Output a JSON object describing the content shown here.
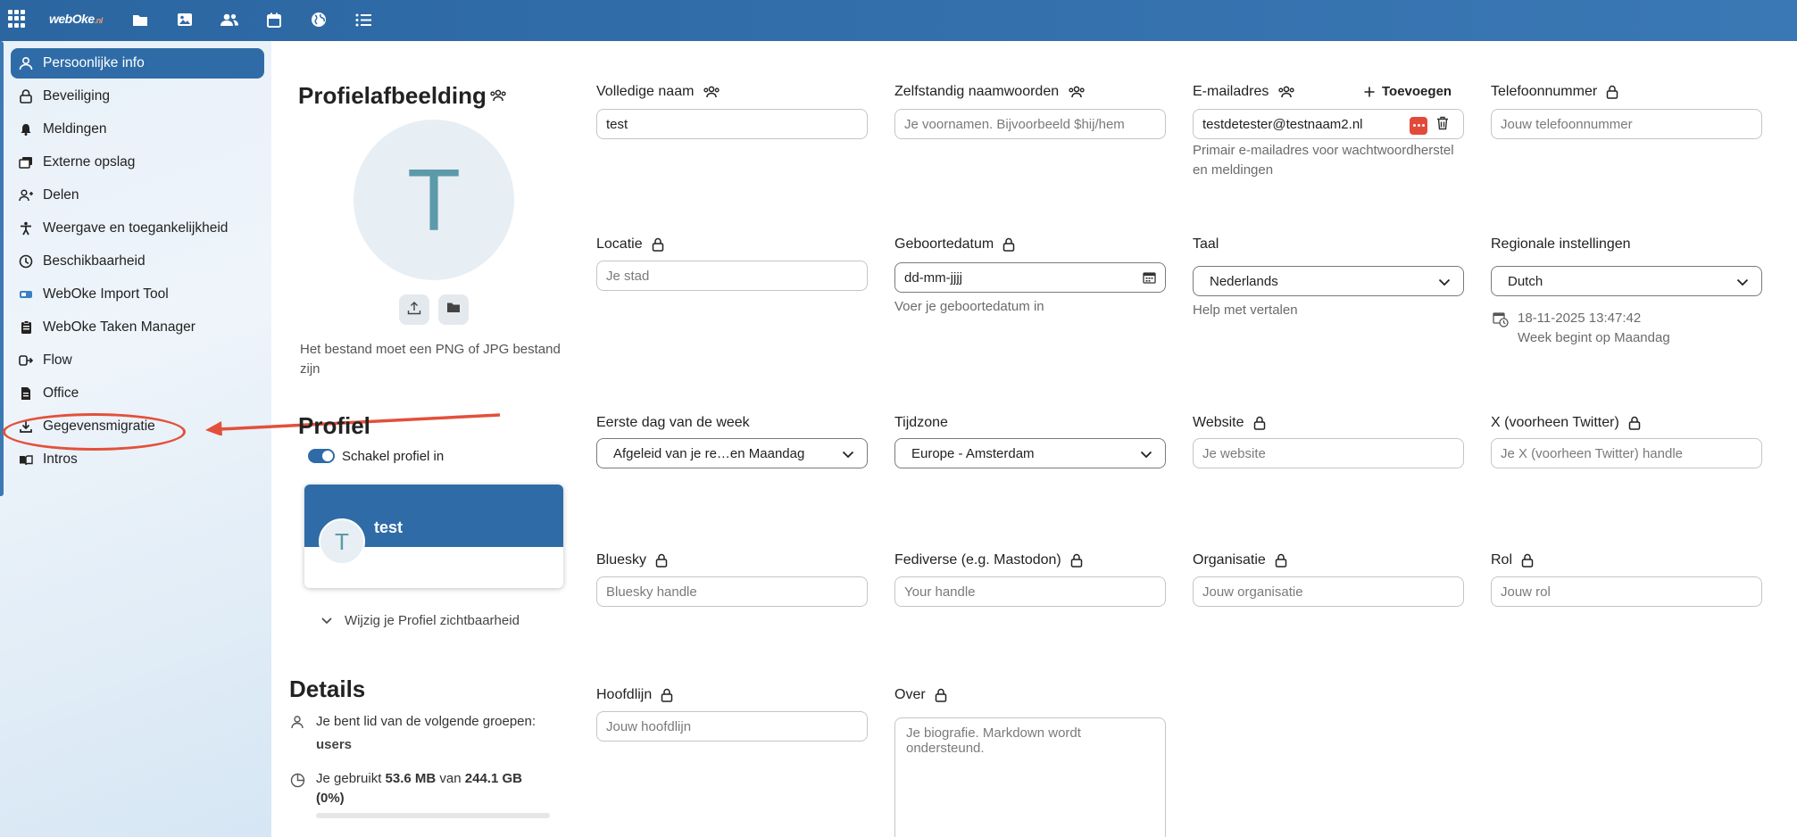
{
  "topbar": {
    "logo_main": "webOke",
    "logo_suffix": ".nl",
    "nav_icons": [
      "folder-icon",
      "image-icon",
      "contacts-icon",
      "calendar-icon",
      "globe-icon",
      "list-icon"
    ]
  },
  "sidebar": {
    "items": [
      {
        "label": "Persoonlijke info",
        "icon": "person-icon",
        "active": true
      },
      {
        "label": "Beveiliging",
        "icon": "lock-icon"
      },
      {
        "label": "Meldingen",
        "icon": "bell-icon"
      },
      {
        "label": "Externe opslag",
        "icon": "external-storage-icon"
      },
      {
        "label": "Delen",
        "icon": "share-icon"
      },
      {
        "label": "Weergave en toegankelijkheid",
        "icon": "accessibility-icon"
      },
      {
        "label": "Beschikbaarheid",
        "icon": "clock-icon"
      },
      {
        "label": "WebOke Import Tool",
        "icon": "import-tool-icon"
      },
      {
        "label": "WebOke Taken Manager",
        "icon": "clipboard-icon"
      },
      {
        "label": "Flow",
        "icon": "flow-icon"
      },
      {
        "label": "Office",
        "icon": "document-icon"
      },
      {
        "label": "Gegevensmigratie",
        "icon": "download-icon"
      },
      {
        "label": "Intros",
        "icon": "book-icon"
      }
    ]
  },
  "profile_picture": {
    "heading": "Profielafbeelding",
    "initial": "T",
    "hint": "Het bestand moet een PNG of JPG bestand zijn"
  },
  "profile": {
    "heading": "Profiel",
    "toggle_label": "Schakel profiel in",
    "card_initial": "T",
    "card_name": "test",
    "visibility_label": "Wijzig je Profiel zichtbaarheid"
  },
  "details": {
    "heading": "Details",
    "groups_text": "Je bent lid van de volgende groepen:",
    "groups_value": "users",
    "usage_prefix": "Je gebruikt",
    "usage_used": "53.6 MB",
    "usage_mid": "van",
    "usage_total": "244.1 GB",
    "usage_percent": "(0%)",
    "usage_fraction": 0.0002
  },
  "fields": {
    "full_name": {
      "label": "Volledige naam",
      "value": "test"
    },
    "pronouns": {
      "label": "Zelfstandig naamwoorden",
      "placeholder": "Je voornamen. Bijvoorbeeld $hij/hem"
    },
    "email": {
      "label": "E-mailadres",
      "add_label": "Toevoegen",
      "value": "testdetester@testnaam2.nl",
      "hint": "Primair e-mailadres voor wachtwoordherstel en meldingen"
    },
    "phone": {
      "label": "Telefoonnummer",
      "placeholder": "Jouw telefoonnummer"
    },
    "location": {
      "label": "Locatie",
      "placeholder": "Je stad"
    },
    "birthdate": {
      "label": "Geboortedatum",
      "placeholder": "dd-mm-jjjj",
      "hint": "Voer je geboortedatum in"
    },
    "language": {
      "label": "Taal",
      "value": "Nederlands",
      "hint": "Help met vertalen"
    },
    "locale": {
      "label": "Regionale instellingen",
      "value": "Dutch",
      "datetime": "18-11-2025 13:47:42",
      "week_start": "Week begint op Maandag"
    },
    "first_day": {
      "label": "Eerste dag van de week",
      "value": "Afgeleid van je re…en Maandag"
    },
    "timezone": {
      "label": "Tijdzone",
      "value": "Europe - Amsterdam"
    },
    "website": {
      "label": "Website",
      "placeholder": "Je website"
    },
    "twitter": {
      "label": "X (voorheen Twitter)",
      "placeholder": "Je X (voorheen Twitter) handle"
    },
    "bluesky": {
      "label": "Bluesky",
      "placeholder": "Bluesky handle"
    },
    "fediverse": {
      "label": "Fediverse (e.g. Mastodon)",
      "placeholder": "Your handle"
    },
    "organisation": {
      "label": "Organisatie",
      "placeholder": "Jouw organisatie"
    },
    "role": {
      "label": "Rol",
      "placeholder": "Jouw rol"
    },
    "headline": {
      "label": "Hoofdlijn",
      "placeholder": "Jouw hoofdlijn"
    },
    "about": {
      "label": "Over",
      "placeholder": "Je biografie. Markdown wordt ondersteund."
    }
  },
  "colors": {
    "primary": "#2f6ca7",
    "annotation": "#e3503a",
    "avatar_text": "#5c9aaa"
  }
}
